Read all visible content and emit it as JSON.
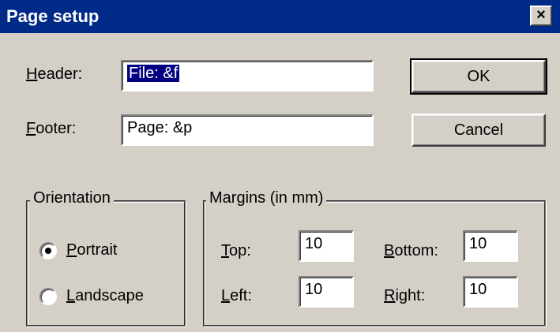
{
  "window": {
    "title": "Page setup",
    "close_glyph": "×"
  },
  "header": {
    "label_accel": "H",
    "label_rest": "eader:",
    "value": "File: &f"
  },
  "footer": {
    "label_accel": "F",
    "label_rest": "ooter:",
    "value": "Page: &p"
  },
  "buttons": {
    "ok": "OK",
    "cancel": "Cancel"
  },
  "orientation": {
    "legend": "Orientation",
    "portrait_accel": "P",
    "portrait_rest": "ortrait",
    "landscape_accel": "L",
    "landscape_rest": "andscape",
    "selected": "portrait"
  },
  "margins": {
    "legend": "Margins (in mm)",
    "top_accel": "T",
    "top_rest": "op:",
    "top_value": "10",
    "bottom_accel": "B",
    "bottom_rest": "ottom:",
    "bottom_value": "10",
    "left_accel": "L",
    "left_rest": "eft:",
    "left_value": "10",
    "right_accel": "R",
    "right_rest": "ight:",
    "right_value": "10"
  }
}
